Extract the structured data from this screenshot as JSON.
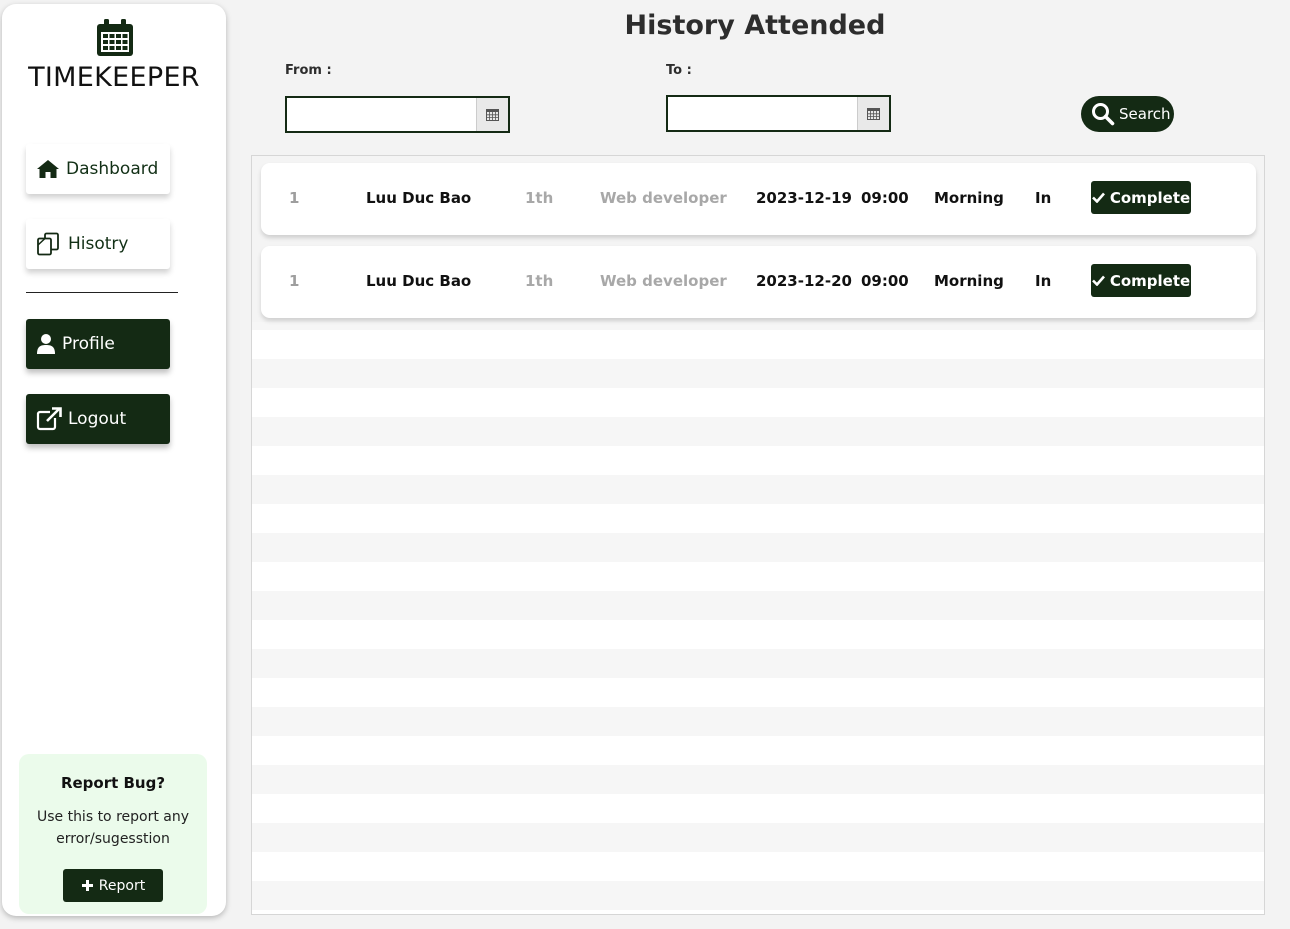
{
  "app": {
    "brand": "TIMEKEEPER",
    "accent_color": "#142a14"
  },
  "sidebar": {
    "items": [
      {
        "label": "Dashboard",
        "icon": "home-icon"
      },
      {
        "label": "Hisotry",
        "icon": "copy-icon"
      },
      {
        "label": "Profile",
        "icon": "user-icon"
      },
      {
        "label": "Logout",
        "icon": "external-link-icon"
      }
    ],
    "report": {
      "title": "Report Bug?",
      "text": "Use this to report any error/sugesstion",
      "button_label": "Report"
    }
  },
  "main": {
    "title": "History Attended",
    "filters": {
      "from_label": "From :",
      "from_value": "",
      "to_label": "To :",
      "to_value": "",
      "search_label": "Search"
    },
    "rows": [
      {
        "id": "1",
        "name": "Luu Duc Bao",
        "session": "1th",
        "role": "Web developer",
        "date": "2023-12-19",
        "time": "09:00",
        "shift": "Morning",
        "direction": "In",
        "status": "Complete"
      },
      {
        "id": "1",
        "name": "Luu Duc Bao",
        "session": "1th",
        "role": "Web developer",
        "date": "2023-12-20",
        "time": "09:00",
        "shift": "Morning",
        "direction": "In",
        "status": "Complete"
      }
    ]
  }
}
